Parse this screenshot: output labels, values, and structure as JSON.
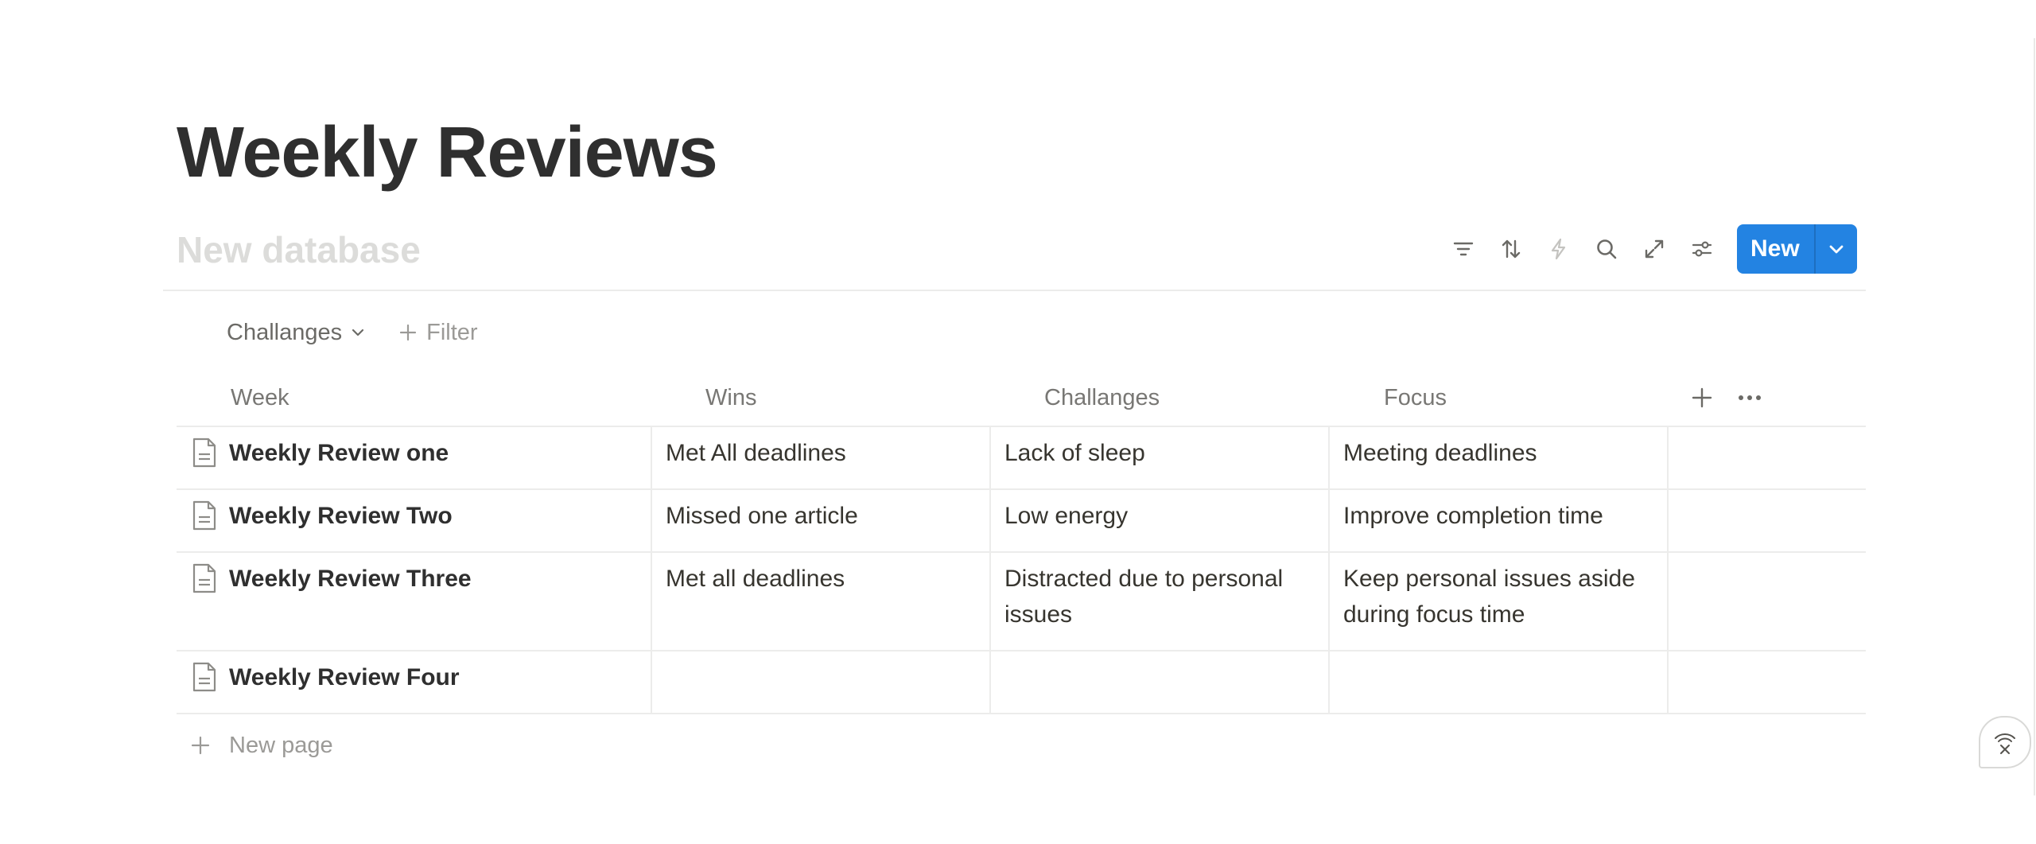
{
  "page": {
    "title": "Weekly Reviews"
  },
  "database": {
    "title_placeholder": "New database",
    "toolbar": {
      "icons": [
        "filter-icon",
        "sort-icon",
        "automation-icon",
        "search-icon",
        "expand-icon",
        "settings-icon"
      ],
      "new_label": "New"
    },
    "filter_bar": {
      "active_filter": "Challanges",
      "add_filter_label": "Filter"
    },
    "columns": [
      "Week",
      "Wins",
      "Challanges",
      "Focus"
    ],
    "rows": [
      {
        "week": "Weekly Review one",
        "wins": "Met All deadlines",
        "challanges": "Lack of sleep",
        "focus": "Meeting deadlines"
      },
      {
        "week": "Weekly Review Two",
        "wins": "Missed one article",
        "challanges": "Low energy",
        "focus": "Improve completion time"
      },
      {
        "week": "Weekly Review Three",
        "wins": "Met all deadlines",
        "challanges": "Distracted due to personal issues",
        "focus": "Keep personal issues aside during focus time"
      },
      {
        "week": "Weekly Review Four",
        "wins": "",
        "challanges": "",
        "focus": ""
      }
    ],
    "new_page_label": "New page"
  },
  "colors": {
    "accent": "#2383e2",
    "text": "#37352f",
    "muted": "#787774",
    "border": "#ececeb"
  }
}
